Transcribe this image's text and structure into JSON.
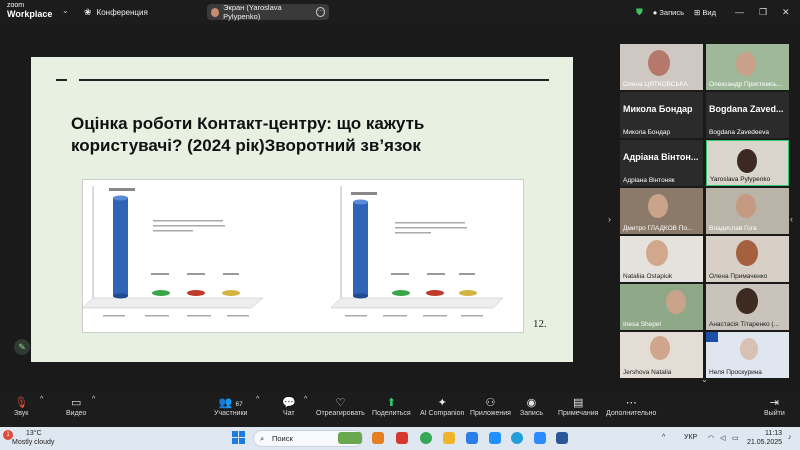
{
  "app": {
    "logo_line1": "zoom",
    "logo_line2": "Workplace",
    "meeting_title": "Конференция"
  },
  "screen_share": {
    "label": "Экран (Yaroslava Pylypenko)"
  },
  "top_right": {
    "record": "Запись",
    "view": "Вид"
  },
  "slide": {
    "title": "Оцінка роботи Контакт-центру: що кажуть користувачі? (2024 рік)Зворотний зв’язок",
    "page_number": "12."
  },
  "participants": [
    {
      "name": "Олена ЦЯТКОВСЬКА",
      "big": ""
    },
    {
      "name": "Олександр Пристемсь...",
      "big": ""
    },
    {
      "name": "Микола Бондар",
      "big": "Микола Бондар"
    },
    {
      "name": "Bogdana Zavedeeva",
      "big": "Bogdana Zaved..."
    },
    {
      "name": "Адріана Вінтоняк",
      "big": "Адріана Вінтон..."
    },
    {
      "name": "Yaroslava Pylypenko",
      "big": ""
    },
    {
      "name": "Дмитро ГЛАДКОВ По...",
      "big": ""
    },
    {
      "name": "Владислав Гога",
      "big": ""
    },
    {
      "name": "Nataliia Ostapiuk",
      "big": ""
    },
    {
      "name": "Олена Примаченко",
      "big": ""
    },
    {
      "name": "Inesa Shepel",
      "big": ""
    },
    {
      "name": "Анастасія Тітаренко (...",
      "big": ""
    },
    {
      "name": "Jershova Natalia",
      "big": ""
    },
    {
      "name": "Неля Проскурина",
      "big": ""
    }
  ],
  "toolbar": {
    "audio": "Звук",
    "video": "Видео",
    "participants": "Участники",
    "participants_count": "67",
    "chat": "Чат",
    "react": "Отреагировать",
    "share": "Поделиться",
    "ai": "AI Companion",
    "apps": "Приложения",
    "record": "Запись",
    "notes": "Примечания",
    "more": "Дополнительно",
    "leave": "Выйти"
  },
  "taskbar": {
    "temp": "13°C",
    "weather": "Mostly cloudy",
    "search_placeholder": "Поиск",
    "lang": "УКР",
    "time": "11:13",
    "date": "21.05.2025",
    "badge": "1"
  }
}
